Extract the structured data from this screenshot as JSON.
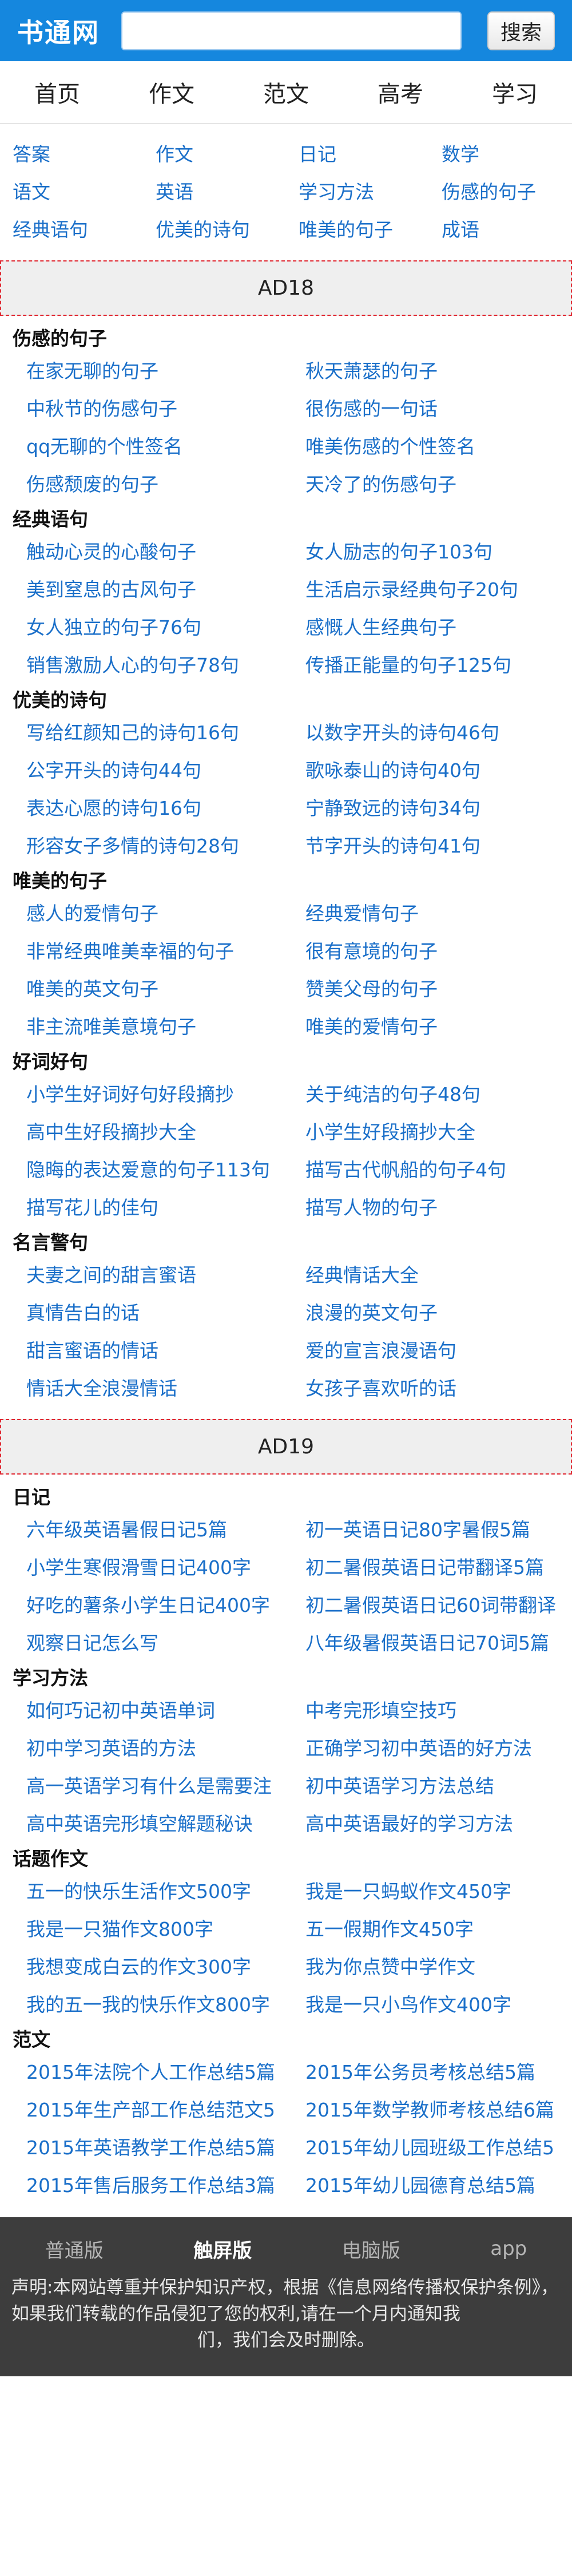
{
  "header": {
    "logo": "书通网",
    "search_placeholder": "",
    "search_button": "搜索"
  },
  "nav": [
    "首页",
    "作文",
    "范文",
    "高考",
    "学习"
  ],
  "categories": [
    "答案",
    "作文",
    "日记",
    "数学",
    "语文",
    "英语",
    "学习方法",
    "伤感的句子",
    "经典语句",
    "优美的诗句",
    "唯美的句子",
    "成语"
  ],
  "ads": [
    "AD18",
    "AD19"
  ],
  "sections_a": [
    {
      "title": "伤感的句子",
      "links": [
        "在家无聊的句子",
        "秋天萧瑟的句子",
        "中秋节的伤感句子",
        "很伤感的一句话",
        "qq无聊的个性签名",
        "唯美伤感的个性签名",
        "伤感颓废的句子",
        "天冷了的伤感句子"
      ]
    },
    {
      "title": "经典语句",
      "links": [
        "触动心灵的心酸句子",
        "女人励志的句子103句",
        "美到窒息的古风句子",
        "生活启示录经典句子20句",
        "女人独立的句子76句",
        "感慨人生经典句子",
        "销售激励人心的句子78句",
        "传播正能量的句子125句"
      ]
    },
    {
      "title": "优美的诗句",
      "links": [
        "写给红颜知己的诗句16句",
        "以数字开头的诗句46句",
        "公字开头的诗句44句",
        "歌咏泰山的诗句40句",
        "表达心愿的诗句16句",
        "宁静致远的诗句34句",
        "形容女子多情的诗句28句",
        "节字开头的诗句41句"
      ]
    },
    {
      "title": "唯美的句子",
      "links": [
        "感人的爱情句子",
        "经典爱情句子",
        "非常经典唯美幸福的句子",
        "很有意境的句子",
        "唯美的英文句子",
        "赞美父母的句子",
        "非主流唯美意境句子",
        "唯美的爱情句子"
      ]
    },
    {
      "title": "好词好句",
      "links": [
        "小学生好词好句好段摘抄",
        "关于纯洁的句子48句",
        "高中生好段摘抄大全",
        "小学生好段摘抄大全",
        "隐晦的表达爱意的句子113句",
        "描写古代帆船的句子4句",
        "描写花儿的佳句",
        "描写人物的句子"
      ]
    },
    {
      "title": "名言警句",
      "links": [
        "夫妻之间的甜言蜜语",
        "经典情话大全",
        "真情告白的话",
        "浪漫的英文句子",
        "甜言蜜语的情话",
        "爱的宣言浪漫语句",
        "情话大全浪漫情话",
        "女孩子喜欢听的话"
      ]
    }
  ],
  "sections_b": [
    {
      "title": "日记",
      "links": [
        "六年级英语暑假日记5篇",
        "初一英语日记80字暑假5篇",
        "小学生寒假滑雪日记400字",
        "初二暑假英语日记带翻译5篇",
        "好吃的薯条小学生日记400字",
        "初二暑假英语日记60词带翻译",
        "观察日记怎么写",
        "八年级暑假英语日记70词5篇"
      ]
    },
    {
      "title": "学习方法",
      "links": [
        "如何巧记初中英语单词",
        "中考完形填空技巧",
        "初中学习英语的方法",
        "正确学习初中英语的好方法",
        "高一英语学习有什么是需要注",
        "初中英语学习方法总结",
        "高中英语完形填空解题秘诀",
        "高中英语最好的学习方法"
      ]
    },
    {
      "title": "话题作文",
      "links": [
        "五一的快乐生活作文500字",
        "我是一只蚂蚁作文450字",
        "我是一只猫作文800字",
        "五一假期作文450字",
        "我想变成白云的作文300字",
        "我为你点赞中学作文",
        "我的五一我的快乐作文800字",
        "我是一只小鸟作文400字"
      ]
    },
    {
      "title": "范文",
      "links": [
        "2015年法院个人工作总结5篇",
        "2015年公务员考核总结5篇",
        "2015年生产部工作总结范文5",
        "2015年数学教师考核总结6篇",
        "2015年英语教学工作总结5篇",
        "2015年幼儿园班级工作总结5",
        "2015年售后服务工作总结3篇",
        "2015年幼儿园德育总结5篇"
      ]
    }
  ],
  "footer": {
    "tabs": [
      "普通版",
      "触屏版",
      "电脑版",
      "app"
    ],
    "active_tab": "触屏版",
    "notice_1": "声明:本网站尊重并保护知识产权，根据《信息网络传播权保护条例》，如果我们转载的作品侵犯了您的权利,请在一个月内通知我",
    "notice_2": "们，我们会及时删除。"
  },
  "colors": {
    "brand": "#1587de",
    "link": "#1a6fc9",
    "ad_border": "#e0262f",
    "footer_bg": "#3d3d3d"
  }
}
